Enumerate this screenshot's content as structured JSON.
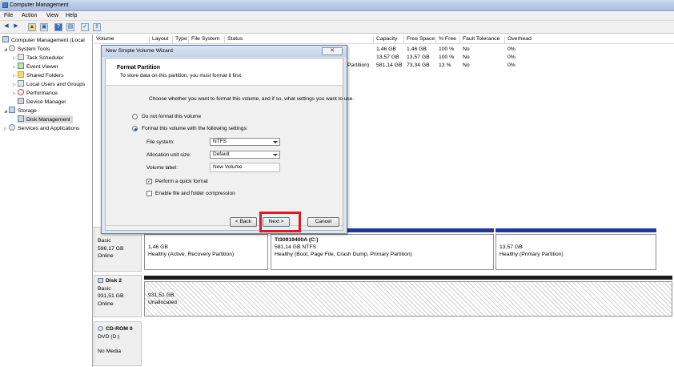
{
  "window": {
    "title": "Computer Management"
  },
  "menu": [
    "File",
    "Action",
    "View",
    "Help"
  ],
  "toolbar": {
    "icons": [
      "back-arrow-icon",
      "forward-arrow-icon",
      "folder-up-icon",
      "properties-icon",
      "help-icon",
      "list-view-icon",
      "check-icon",
      "export-icon"
    ],
    "glyphs": [
      "◀",
      "▶",
      "▲",
      "▣",
      "?",
      "▤",
      "✓",
      "⇪"
    ]
  },
  "tree": {
    "root": "Computer Management (Local",
    "items": [
      {
        "label": "System Tools",
        "level": 1,
        "icon": "tools-icon"
      },
      {
        "label": "Task Scheduler",
        "level": 2,
        "icon": "clock-icon"
      },
      {
        "label": "Event Viewer",
        "level": 2,
        "icon": "event-viewer-icon"
      },
      {
        "label": "Shared Folders",
        "level": 2,
        "icon": "folder-icon"
      },
      {
        "label": "Local Users and Groups",
        "level": 2,
        "icon": "users-icon"
      },
      {
        "label": "Performance",
        "level": 2,
        "icon": "performance-icon"
      },
      {
        "label": "Device Manager",
        "level": 2,
        "icon": "device-manager-icon"
      },
      {
        "label": "Storage",
        "level": 1,
        "icon": "storage-icon"
      },
      {
        "label": "Disk Management",
        "level": 2,
        "icon": "disk-icon",
        "selected": true
      },
      {
        "label": "Services and Applications",
        "level": 1,
        "icon": "services-icon"
      }
    ]
  },
  "columns": [
    "Volume",
    "Layout",
    "Type",
    "File System",
    "Status",
    "Capacity",
    "Free Space",
    "% Free",
    "Fault Tolerance",
    "Overhead"
  ],
  "rows": [
    {
      "capacity": "1,46 GB",
      "free": "1,46 GB",
      "pct": "100 %",
      "fault": "No",
      "overhead": "0%"
    },
    {
      "capacity": "13,57 GB",
      "free": "13,57 GB",
      "pct": "100 %",
      "fault": "No",
      "overhead": "0%"
    },
    {
      "status_tail": "Partition)",
      "capacity": "581,14 GB",
      "free": "73,34 GB",
      "pct": "13 %",
      "fault": "No",
      "overhead": "0%"
    }
  ],
  "disks": {
    "disk0": {
      "type": "Basic",
      "size": "596,17 GB",
      "state": "Online",
      "partitions": [
        {
          "name": "",
          "size": "1,46 GB",
          "status": "Healthy (Active, Recovery Partition)"
        },
        {
          "name": "TI30919400A  (C:)",
          "size": "581,14 GB NTFS",
          "status": "Healthy (Boot, Page File, Crash Dump, Primary Partition)"
        },
        {
          "name": "",
          "size": "13,57 GB",
          "status": "Healthy (Primary Partition)"
        }
      ]
    },
    "disk2": {
      "name": "Disk 2",
      "type": "Basic",
      "size": "931,51 GB",
      "state": "Online",
      "part_size": "931,51 GB",
      "part_status": "Unallocated"
    },
    "cdrom": {
      "name": "CD-ROM 0",
      "type": "DVD (D:)",
      "media": "No Media"
    }
  },
  "wizard": {
    "title": "New Simple Volume Wizard",
    "close": "✕",
    "heading": "Format Partition",
    "subheading": "To store data on this partition, you must format it first.",
    "question": "Choose whether you want to format this volume, and if so, what settings you want to use.",
    "opt_no_format": "Do not format this volume",
    "opt_format": "Format this volume with the following settings:",
    "fs_label": "File system:",
    "fs_value": "NTFS",
    "alloc_label": "Allocation unit size:",
    "alloc_value": "Default",
    "vol_label": "Volume label:",
    "vol_value": "New Volume",
    "quick_format": "Perform a quick format",
    "compression": "Enable file and folder compression",
    "back": "< Back",
    "next": "Next >",
    "cancel": "Cancel"
  },
  "colors": {
    "highlight_box": "#e0191f",
    "disk_bar": "#1f3a93"
  }
}
